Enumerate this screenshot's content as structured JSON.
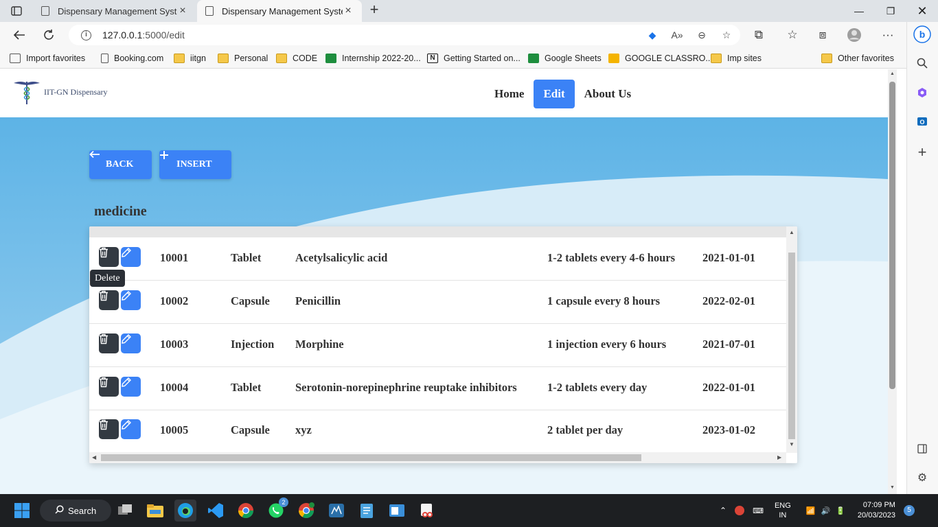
{
  "browser": {
    "tabs": [
      {
        "title": "Dispensary Management System",
        "active": false
      },
      {
        "title": "Dispensary Management System",
        "active": true
      }
    ],
    "url_host": "127.0.0.1",
    "url_path": ":5000/edit",
    "favorites": [
      {
        "label": "Import favorites",
        "icon": "import-icon"
      },
      {
        "label": "Booking.com",
        "icon": "page-icon"
      },
      {
        "label": "iitgn",
        "icon": "folder-icon"
      },
      {
        "label": "Personal",
        "icon": "folder-icon"
      },
      {
        "label": "CODE",
        "icon": "folder-icon"
      },
      {
        "label": "Internship 2022-20...",
        "icon": "sheets-icon"
      },
      {
        "label": "Getting Started on...",
        "icon": "notion-icon"
      },
      {
        "label": "Google Sheets",
        "icon": "sheets-icon"
      },
      {
        "label": "GOOGLE CLASSRO...",
        "icon": "classroom-icon"
      },
      {
        "label": "Imp sites",
        "icon": "folder-icon"
      },
      {
        "label": "Other favorites",
        "icon": "folder-icon"
      }
    ]
  },
  "site": {
    "logo_text": "IIT-GN Dispensary",
    "nav": [
      {
        "label": "Home",
        "active": false
      },
      {
        "label": "Edit",
        "active": true
      },
      {
        "label": "About Us",
        "active": false
      }
    ],
    "back_label": "BACK",
    "insert_label": "INSERT",
    "section_title": "medicine",
    "tooltip": "Delete",
    "rows": [
      {
        "id": "10001",
        "type": "Tablet",
        "name": "Acetylsalicylic acid",
        "dosage": "1-2 tablets every 4-6 hours",
        "date": "2021-01-01"
      },
      {
        "id": "10002",
        "type": "Capsule",
        "name": "Penicillin",
        "dosage": "1 capsule every 8 hours",
        "date": "2022-02-01"
      },
      {
        "id": "10003",
        "type": "Injection",
        "name": "Morphine",
        "dosage": "1 injection every 6 hours",
        "date": "2021-07-01"
      },
      {
        "id": "10004",
        "type": "Tablet",
        "name": "Serotonin-norepinephrine reuptake inhibitors",
        "dosage": "1-2 tablets every day",
        "date": "2022-01-01"
      },
      {
        "id": "10005",
        "type": "Capsule",
        "name": "xyz",
        "dosage": "2 tablet per day",
        "date": "2023-01-02"
      }
    ]
  },
  "taskbar": {
    "search_label": "Search",
    "lang_top": "ENG",
    "lang_bottom": "IN",
    "time": "07:09 PM",
    "date": "20/03/2023",
    "notification_count": "5",
    "whatsapp_badge": "2"
  },
  "colors": {
    "accent": "#3b82f6",
    "delete_button": "#333a42",
    "taskbar": "#1d1f22"
  }
}
